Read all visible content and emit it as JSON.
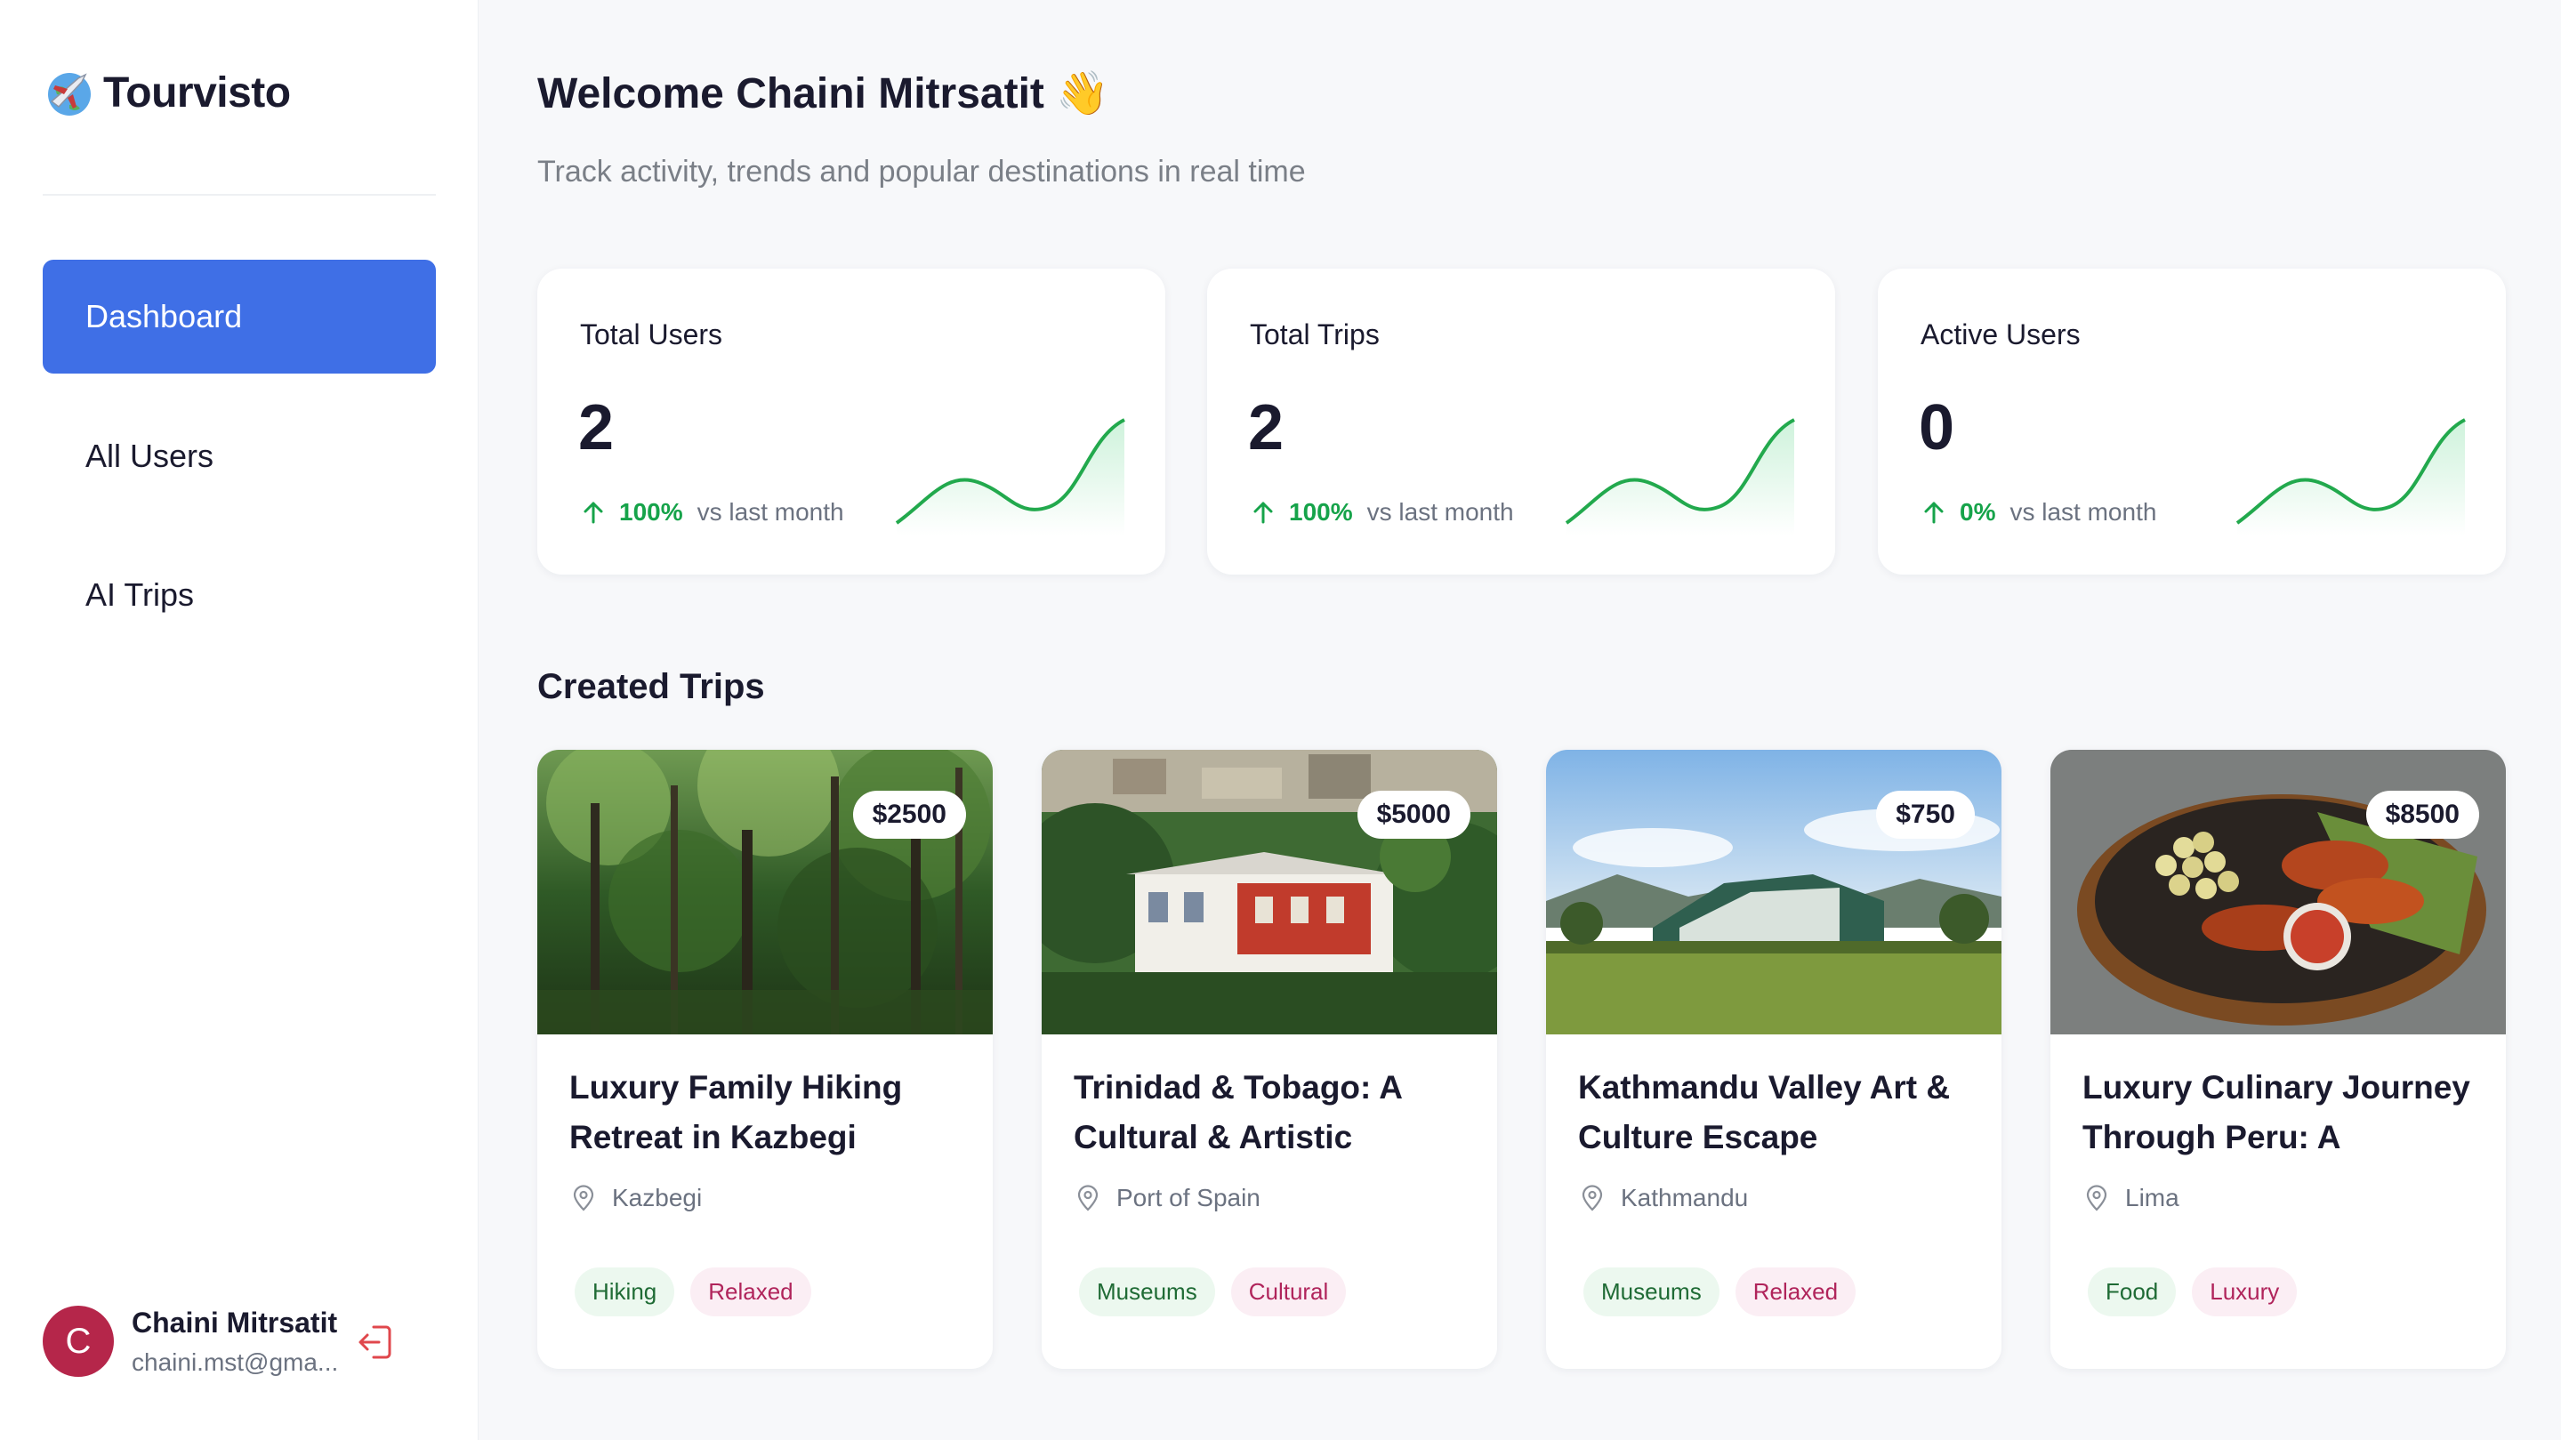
{
  "brand": {
    "name": "Tourvisto",
    "logo_icon": "globe-plane-icon"
  },
  "nav": [
    {
      "label": "Dashboard",
      "active": true
    },
    {
      "label": "All Users",
      "active": false
    },
    {
      "label": "AI Trips",
      "active": false
    }
  ],
  "user": {
    "initial": "C",
    "name": "Chaini Mitrsatit",
    "email": "chaini.mst@gma...",
    "avatar_color": "#b5264a",
    "logout_icon": "logout-icon"
  },
  "header": {
    "title": "Welcome Chaini Mitrsatit 👋",
    "subtitle": "Track activity, trends and popular destinations in real time"
  },
  "stats": [
    {
      "label": "Total Users",
      "value": "2",
      "change": "100%",
      "compare": "vs last month"
    },
    {
      "label": "Total Trips",
      "value": "2",
      "change": "100%",
      "compare": "vs last month"
    },
    {
      "label": "Active Users",
      "value": "0",
      "change": "0%",
      "compare": "vs last month"
    }
  ],
  "trips_section": {
    "title": "Created Trips",
    "trips": [
      {
        "title": "Luxury Family Hiking Retreat in Kazbegi",
        "location": "Kazbegi",
        "price": "$2500",
        "tags": [
          "Hiking",
          "Relaxed"
        ],
        "image": "forest"
      },
      {
        "title": "Trinidad & Tobago: A Cultural & Artistic Journey",
        "location": "Port of Spain",
        "price": "$5000",
        "tags": [
          "Museums",
          "Cultural"
        ],
        "image": "colonial-house"
      },
      {
        "title": "Kathmandu Valley Art & Culture Escape",
        "location": "Kathmandu",
        "price": "$750",
        "tags": [
          "Museums",
          "Relaxed"
        ],
        "image": "museum-lawn"
      },
      {
        "title": "Luxury Culinary Journey Through Peru: A Couple's...",
        "location": "Lima",
        "price": "$8500",
        "tags": [
          "Food",
          "Luxury"
        ],
        "image": "food-platter"
      }
    ]
  },
  "colors": {
    "accent": "#3f6fe6",
    "positive": "#16a34a",
    "tag_green_bg": "#ecf8ef",
    "tag_pink_bg": "#fbeef4"
  }
}
